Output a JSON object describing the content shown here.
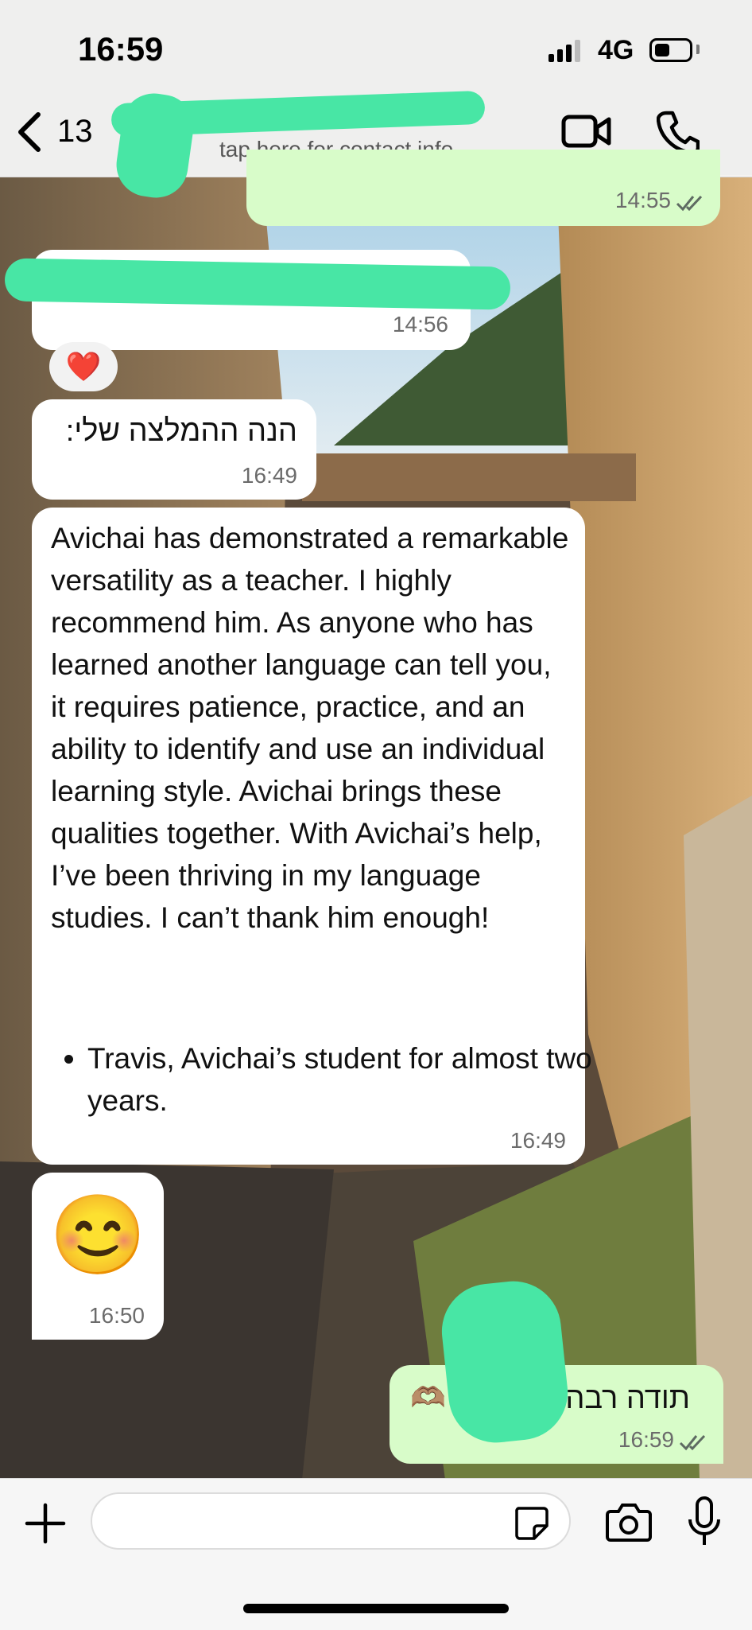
{
  "status_bar": {
    "time": "16:59",
    "network": "4G",
    "battery_level": 0.45
  },
  "header": {
    "back_count": "13",
    "contact_name": "",
    "contact_subtitle": "tap here for contact info"
  },
  "messages": [
    {
      "direction": "outgoing",
      "time": "14:55",
      "ticks": "read"
    },
    {
      "direction": "incoming",
      "time": "14:56",
      "reaction": "❤️"
    },
    {
      "direction": "incoming",
      "text": "הנה ההמלצה שלי:",
      "time": "16:49"
    },
    {
      "direction": "incoming",
      "text": "Avichai has demonstrated a remarkable versatility as a teacher. I highly recommend him. As anyone who has learned another language can tell you, it requires patience, practice, and an ability to identify and use an individual learning style. Avichai brings these qualities together. With Avichai’s help, I’ve been thriving in my language studies. I can’t thank him enough!",
      "bullet": "Travis, Avichai’s student for almost two years.",
      "time": "16:49"
    },
    {
      "direction": "incoming",
      "emoji": "😊",
      "time": "16:50"
    },
    {
      "direction": "outgoing",
      "text": "תודה רבה",
      "emoji": "🫶🏽",
      "time": "16:59",
      "ticks": "read"
    }
  ],
  "colors": {
    "accent_green": "#48e6a5",
    "outgoing_bubble": "#d8fcc9",
    "incoming_bubble": "#ffffff"
  }
}
